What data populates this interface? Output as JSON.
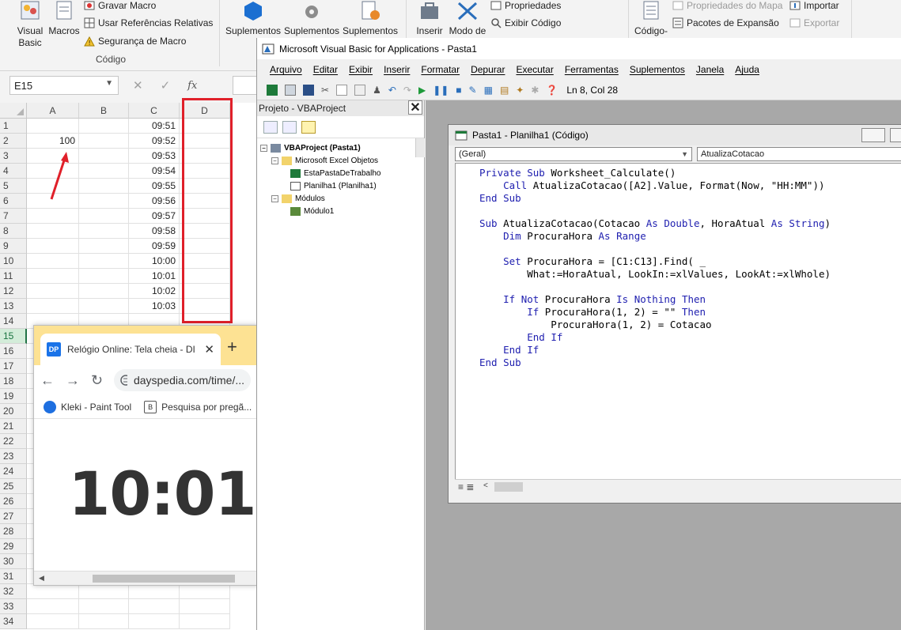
{
  "ribbon": {
    "visual_basic": "Visual Basic",
    "macros": "Macros",
    "gravar_macro": "Gravar Macro",
    "usar_referencias": "Usar Referências Relativas",
    "seguranca_macro": "Segurança de Macro",
    "group_codigo": "Código",
    "suplementos": [
      "Suplementos",
      "Suplementos",
      "Suplementos"
    ],
    "inserir": "Inserir",
    "modo_de": "Modo de",
    "propriedades": "Propriedades",
    "exibir_codigo": "Exibir Código",
    "codigo_fonte": "Código-",
    "propriedades_mapa": "Propriedades do Mapa",
    "pacotes_expansao": "Pacotes de Expansão",
    "importar": "Importar",
    "exportar": "Exportar"
  },
  "formula_bar": {
    "name_box": "E15",
    "fx": "fx"
  },
  "sheet": {
    "columns": [
      "A",
      "B",
      "C",
      "D"
    ],
    "rows": [
      "1",
      "2",
      "3",
      "4",
      "5",
      "6",
      "7",
      "8",
      "9",
      "10",
      "11",
      "12",
      "13",
      "14",
      "15",
      "16",
      "17",
      "18",
      "19",
      "20",
      "21",
      "22",
      "23",
      "24",
      "25",
      "26",
      "27",
      "28",
      "29",
      "30",
      "31",
      "32",
      "33",
      "34"
    ],
    "a2": "100",
    "col_c": [
      "09:51",
      "09:52",
      "09:53",
      "09:54",
      "09:55",
      "09:56",
      "09:57",
      "09:58",
      "09:59",
      "10:00",
      "10:01",
      "10:02",
      "10:03"
    ]
  },
  "chrome": {
    "tab_title": "Relógio Online: Tela cheia - DI",
    "tab_logo": "DP",
    "url": "dayspedia.com/time/...",
    "bookmarks": [
      "Kleki - Paint Tool",
      "Pesquisa por pregã..."
    ],
    "clock": "10:01"
  },
  "vba": {
    "title": "Microsoft Visual Basic for Applications - Pasta1",
    "menu": [
      "Arquivo",
      "Editar",
      "Exibir",
      "Inserir",
      "Formatar",
      "Depurar",
      "Executar",
      "Ferramentas",
      "Suplementos",
      "Janela",
      "Ajuda"
    ],
    "status": "Ln 8, Col 28",
    "project_title": "Projeto - VBAProject",
    "tree": [
      "VBAProject (Pasta1)",
      "Microsoft Excel Objetos",
      "EstaPastaDeTrabalho",
      "Planilha1 (Planilha1)",
      "Módulos",
      "Módulo1"
    ],
    "code_window_title": "Pasta1 - Planilha1 (Código)",
    "combo_left": "(Geral)",
    "combo_right": "AtualizaCotacao",
    "code": [
      "Private Sub Worksheet_Calculate()",
      "    Call AtualizaCotacao([A2].Value, Format(Now, \"HH:MM\"))",
      "End Sub",
      "",
      "Sub AtualizaCotacao(Cotacao As Double, HoraAtual As String)",
      "    Dim ProcuraHora As Range",
      "",
      "    Set ProcuraHora = [C1:C13].Find( _",
      "        What:=HoraAtual, LookIn:=xlValues, LookAt:=xlWhole)",
      "",
      "    If Not ProcuraHora Is Nothing Then",
      "        If ProcuraHora(1, 2) = \"\" Then",
      "            ProcuraHora(1, 2) = Cotacao",
      "        End If",
      "    End If",
      "End Sub"
    ]
  },
  "colors": {
    "excel_green": "#217346",
    "highlight_red": "#e0202a",
    "vba_keyword": "#2020b0"
  }
}
